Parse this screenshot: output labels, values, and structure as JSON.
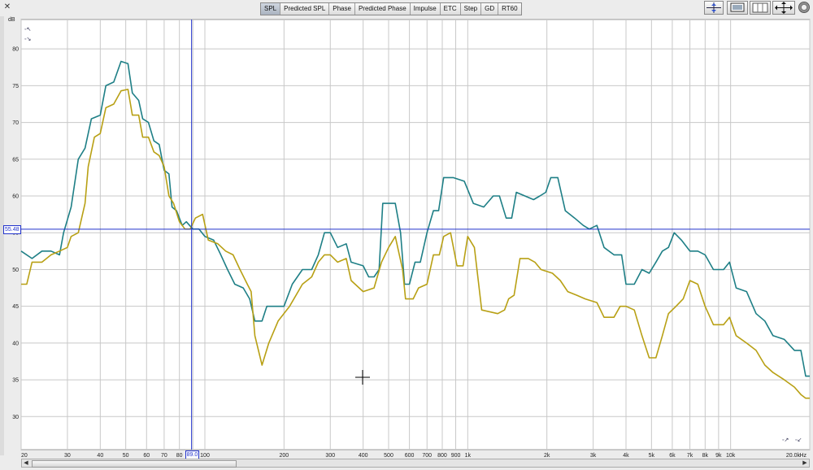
{
  "toolbar": {
    "tabs": [
      {
        "label": "SPL",
        "active": true
      },
      {
        "label": "Predicted SPL",
        "active": false
      },
      {
        "label": "Phase",
        "active": false
      },
      {
        "label": "Predicted Phase",
        "active": false
      },
      {
        "label": "Impulse",
        "active": false
      },
      {
        "label": "ETC",
        "active": false
      },
      {
        "label": "Step",
        "active": false
      },
      {
        "label": "GD",
        "active": false
      },
      {
        "label": "RT60",
        "active": false
      }
    ],
    "icons": [
      "zoom-vertical-icon",
      "zoom-window-icon",
      "grid-panel-icon",
      "pan-arrows-icon",
      "settings-gear-icon"
    ]
  },
  "cursor": {
    "x_label": "89.0",
    "y_label": "55.48"
  },
  "colors": {
    "teal": "#1e7f86",
    "gold": "#b8a014",
    "cursor": "#2233cc",
    "grid": "#c8c8c8"
  },
  "chart_data": {
    "type": "line",
    "title": "",
    "xlabel": "Hz",
    "ylabel": "dB",
    "x_scale": "log",
    "xlim": [
      20,
      20000
    ],
    "ylim": [
      25.5,
      84
    ],
    "grid": true,
    "yticks": [
      30,
      35,
      40,
      45,
      50,
      55,
      60,
      65,
      70,
      75,
      80
    ],
    "xticks": [
      {
        "v": 20,
        "label": "20"
      },
      {
        "v": 30,
        "label": "30"
      },
      {
        "v": 40,
        "label": "40"
      },
      {
        "v": 50,
        "label": "50"
      },
      {
        "v": 60,
        "label": "60"
      },
      {
        "v": 70,
        "label": "70"
      },
      {
        "v": 80,
        "label": "80"
      },
      {
        "v": 100,
        "label": "100"
      },
      {
        "v": 200,
        "label": "200"
      },
      {
        "v": 300,
        "label": "300"
      },
      {
        "v": 400,
        "label": "400"
      },
      {
        "v": 500,
        "label": "500"
      },
      {
        "v": 600,
        "label": "600"
      },
      {
        "v": 700,
        "label": "700"
      },
      {
        "v": 800,
        "label": "800"
      },
      {
        "v": 900,
        "label": "900"
      },
      {
        "v": 1000,
        "label": "1k"
      },
      {
        "v": 2000,
        "label": "2k"
      },
      {
        "v": 3000,
        "label": "3k"
      },
      {
        "v": 4000,
        "label": "4k"
      },
      {
        "v": 5000,
        "label": "5k"
      },
      {
        "v": 6000,
        "label": "6k"
      },
      {
        "v": 7000,
        "label": "7k"
      },
      {
        "v": 8000,
        "label": "8k"
      },
      {
        "v": 9000,
        "label": "9k"
      },
      {
        "v": 10000,
        "label": "10k"
      },
      {
        "v": 20000,
        "label": "20.0k"
      }
    ],
    "cursor": {
      "x": 89.0,
      "y": 55.48
    },
    "series": [
      {
        "color": "#1e7f86",
        "points": [
          [
            20,
            52.5
          ],
          [
            22,
            51.5
          ],
          [
            24,
            52.5
          ],
          [
            26,
            52.5
          ],
          [
            28,
            52
          ],
          [
            29,
            55
          ],
          [
            31,
            58.5
          ],
          [
            33,
            65
          ],
          [
            35,
            66.5
          ],
          [
            37,
            70.5
          ],
          [
            40,
            71
          ],
          [
            42,
            75
          ],
          [
            45,
            75.5
          ],
          [
            48,
            78.3
          ],
          [
            51,
            78
          ],
          [
            53,
            74
          ],
          [
            56,
            73
          ],
          [
            58,
            70.5
          ],
          [
            61,
            70
          ],
          [
            64,
            67.5
          ],
          [
            67,
            67
          ],
          [
            70,
            63.5
          ],
          [
            73,
            63
          ],
          [
            75,
            58.5
          ],
          [
            78,
            58
          ],
          [
            82,
            56
          ],
          [
            85,
            56.5
          ],
          [
            90,
            55.5
          ],
          [
            95,
            55.5
          ],
          [
            100,
            54.5
          ],
          [
            108,
            54
          ],
          [
            115,
            52
          ],
          [
            122,
            50
          ],
          [
            130,
            48
          ],
          [
            140,
            47.5
          ],
          [
            148,
            46
          ],
          [
            155,
            43
          ],
          [
            165,
            43
          ],
          [
            172,
            45
          ],
          [
            200,
            45
          ],
          [
            215,
            48
          ],
          [
            235,
            50
          ],
          [
            255,
            50
          ],
          [
            270,
            52
          ],
          [
            285,
            55
          ],
          [
            300,
            55
          ],
          [
            320,
            53
          ],
          [
            345,
            53.5
          ],
          [
            360,
            51
          ],
          [
            400,
            50.5
          ],
          [
            420,
            49
          ],
          [
            440,
            49
          ],
          [
            460,
            50
          ],
          [
            475,
            59
          ],
          [
            530,
            59
          ],
          [
            555,
            55
          ],
          [
            575,
            48
          ],
          [
            600,
            48
          ],
          [
            630,
            51
          ],
          [
            660,
            51
          ],
          [
            700,
            55
          ],
          [
            740,
            58
          ],
          [
            775,
            58
          ],
          [
            810,
            62.5
          ],
          [
            880,
            62.5
          ],
          [
            970,
            62
          ],
          [
            1050,
            59
          ],
          [
            1150,
            58.5
          ],
          [
            1250,
            60
          ],
          [
            1320,
            60
          ],
          [
            1400,
            57
          ],
          [
            1470,
            57
          ],
          [
            1530,
            60.5
          ],
          [
            1650,
            60
          ],
          [
            1780,
            59.5
          ],
          [
            1880,
            60
          ],
          [
            1980,
            60.5
          ],
          [
            2070,
            62.5
          ],
          [
            2200,
            62.5
          ],
          [
            2350,
            58
          ],
          [
            2550,
            57
          ],
          [
            2750,
            56
          ],
          [
            2900,
            55.5
          ],
          [
            3100,
            56
          ],
          [
            3300,
            53
          ],
          [
            3600,
            52
          ],
          [
            3850,
            52
          ],
          [
            4000,
            48
          ],
          [
            4300,
            48
          ],
          [
            4600,
            50
          ],
          [
            4900,
            49.5
          ],
          [
            5200,
            51
          ],
          [
            5500,
            52.5
          ],
          [
            5800,
            53
          ],
          [
            6100,
            55
          ],
          [
            6500,
            54
          ],
          [
            7000,
            52.5
          ],
          [
            7500,
            52.5
          ],
          [
            8000,
            52
          ],
          [
            8600,
            50
          ],
          [
            9400,
            50
          ],
          [
            9900,
            51
          ],
          [
            10500,
            47.5
          ],
          [
            11500,
            47
          ],
          [
            12500,
            44
          ],
          [
            13500,
            43
          ],
          [
            14500,
            41
          ],
          [
            16000,
            40.5
          ],
          [
            17500,
            39
          ],
          [
            18500,
            39
          ],
          [
            19300,
            35.5
          ],
          [
            20000,
            35.5
          ]
        ]
      },
      {
        "color": "#b8a014",
        "points": [
          [
            20,
            48
          ],
          [
            21,
            48
          ],
          [
            22,
            51
          ],
          [
            24,
            51
          ],
          [
            26,
            52
          ],
          [
            28,
            52.5
          ],
          [
            30,
            53
          ],
          [
            31,
            54.5
          ],
          [
            33,
            55
          ],
          [
            35,
            59
          ],
          [
            36,
            64
          ],
          [
            38,
            68
          ],
          [
            40,
            68.5
          ],
          [
            42,
            72
          ],
          [
            45,
            72.5
          ],
          [
            48,
            74.3
          ],
          [
            51,
            74.5
          ],
          [
            53,
            71
          ],
          [
            56,
            71
          ],
          [
            58,
            68
          ],
          [
            61,
            68
          ],
          [
            64,
            66
          ],
          [
            67,
            65.5
          ],
          [
            70,
            64
          ],
          [
            73,
            60
          ],
          [
            76,
            59
          ],
          [
            80,
            56.5
          ],
          [
            84,
            55.5
          ],
          [
            88,
            55.5
          ],
          [
            92,
            57
          ],
          [
            98,
            57.5
          ],
          [
            103,
            54
          ],
          [
            112,
            53.5
          ],
          [
            120,
            52.5
          ],
          [
            128,
            52
          ],
          [
            136,
            50
          ],
          [
            145,
            48
          ],
          [
            150,
            47
          ],
          [
            155,
            41
          ],
          [
            165,
            37
          ],
          [
            175,
            40
          ],
          [
            190,
            43
          ],
          [
            210,
            45
          ],
          [
            235,
            48
          ],
          [
            255,
            49
          ],
          [
            270,
            51
          ],
          [
            285,
            52
          ],
          [
            300,
            52
          ],
          [
            320,
            51
          ],
          [
            345,
            51.5
          ],
          [
            360,
            48.5
          ],
          [
            400,
            47
          ],
          [
            440,
            47.5
          ],
          [
            470,
            51
          ],
          [
            500,
            53
          ],
          [
            530,
            54.5
          ],
          [
            565,
            50
          ],
          [
            580,
            46
          ],
          [
            620,
            46
          ],
          [
            650,
            47.5
          ],
          [
            700,
            48
          ],
          [
            740,
            52
          ],
          [
            780,
            52
          ],
          [
            810,
            54.5
          ],
          [
            860,
            55
          ],
          [
            910,
            50.5
          ],
          [
            960,
            50.5
          ],
          [
            1000,
            54.5
          ],
          [
            1060,
            53
          ],
          [
            1130,
            44.5
          ],
          [
            1300,
            44
          ],
          [
            1380,
            44.5
          ],
          [
            1430,
            46
          ],
          [
            1500,
            46.5
          ],
          [
            1580,
            51.5
          ],
          [
            1700,
            51.5
          ],
          [
            1800,
            51
          ],
          [
            1900,
            50
          ],
          [
            2100,
            49.5
          ],
          [
            2250,
            48.5
          ],
          [
            2400,
            47
          ],
          [
            2600,
            46.5
          ],
          [
            2800,
            46
          ],
          [
            3100,
            45.5
          ],
          [
            3300,
            43.5
          ],
          [
            3600,
            43.5
          ],
          [
            3800,
            45
          ],
          [
            4000,
            45
          ],
          [
            4300,
            44.5
          ],
          [
            4600,
            41
          ],
          [
            4900,
            38
          ],
          [
            5200,
            38
          ],
          [
            5500,
            41
          ],
          [
            5800,
            44
          ],
          [
            6200,
            45
          ],
          [
            6600,
            46
          ],
          [
            7000,
            48.5
          ],
          [
            7500,
            48
          ],
          [
            8000,
            45
          ],
          [
            8600,
            42.5
          ],
          [
            9400,
            42.5
          ],
          [
            9900,
            43.5
          ],
          [
            10500,
            41
          ],
          [
            11500,
            40
          ],
          [
            12500,
            39
          ],
          [
            13500,
            37
          ],
          [
            14500,
            36
          ],
          [
            16000,
            35
          ],
          [
            17500,
            34
          ],
          [
            18500,
            33
          ],
          [
            19300,
            32.5
          ],
          [
            20000,
            32.5
          ]
        ]
      }
    ]
  }
}
